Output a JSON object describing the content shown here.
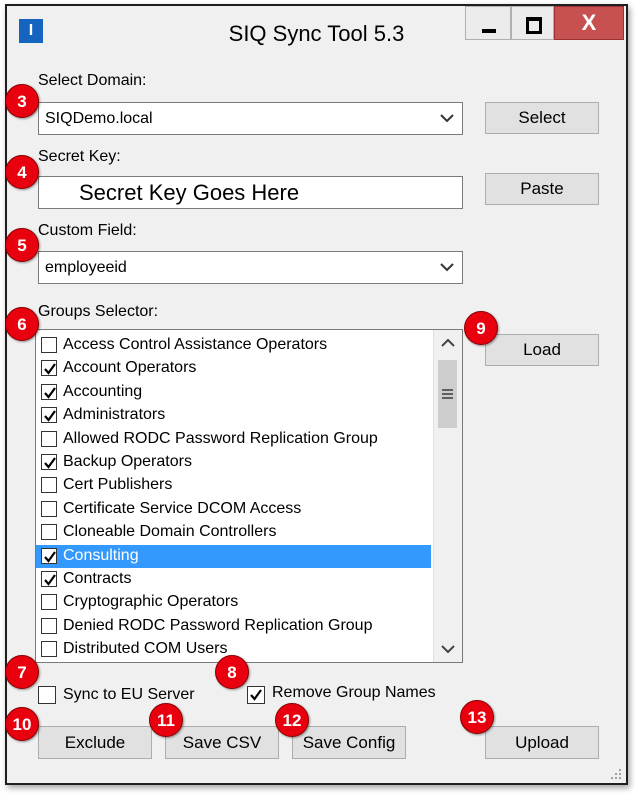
{
  "window": {
    "title": "SIQ Sync Tool 5.3",
    "app_icon_glyph": "I",
    "close_glyph": "X",
    "accent_color": "#1565c0",
    "close_color": "#c75050"
  },
  "domain": {
    "label": "Select Domain:",
    "value": "SIQDemo.local",
    "select_button": "Select"
  },
  "secret": {
    "label": "Secret Key:",
    "value": "Secret Key Goes Here",
    "paste_button": "Paste"
  },
  "custom_field": {
    "label": "Custom Field:",
    "value": "employeeid"
  },
  "groups": {
    "label": "Groups Selector:",
    "load_button": "Load",
    "items": [
      {
        "label": "Access Control Assistance Operators",
        "checked": false,
        "selected": false
      },
      {
        "label": "Account Operators",
        "checked": true,
        "selected": false
      },
      {
        "label": "Accounting",
        "checked": true,
        "selected": false
      },
      {
        "label": "Administrators",
        "checked": true,
        "selected": false
      },
      {
        "label": "Allowed RODC Password Replication Group",
        "checked": false,
        "selected": false
      },
      {
        "label": "Backup Operators",
        "checked": true,
        "selected": false
      },
      {
        "label": "Cert Publishers",
        "checked": false,
        "selected": false
      },
      {
        "label": "Certificate Service DCOM Access",
        "checked": false,
        "selected": false
      },
      {
        "label": "Cloneable Domain Controllers",
        "checked": false,
        "selected": false
      },
      {
        "label": "Consulting",
        "checked": true,
        "selected": true
      },
      {
        "label": "Contracts",
        "checked": true,
        "selected": false
      },
      {
        "label": "Cryptographic Operators",
        "checked": false,
        "selected": false
      },
      {
        "label": "Denied RODC Password Replication Group",
        "checked": false,
        "selected": false
      },
      {
        "label": "Distributed COM Users",
        "checked": false,
        "selected": false
      }
    ]
  },
  "options": {
    "sync_eu": {
      "label": "Sync to EU Server",
      "checked": false
    },
    "remove_group_names": {
      "label": "Remove Group Names",
      "checked": true
    }
  },
  "buttons": {
    "exclude": "Exclude",
    "save_csv": "Save CSV",
    "save_config": "Save Config",
    "upload": "Upload"
  },
  "annotations": {
    "badge_color": "#e8000e",
    "labels": [
      "3",
      "4",
      "5",
      "6",
      "7",
      "8",
      "9",
      "10",
      "11",
      "12",
      "13"
    ]
  }
}
